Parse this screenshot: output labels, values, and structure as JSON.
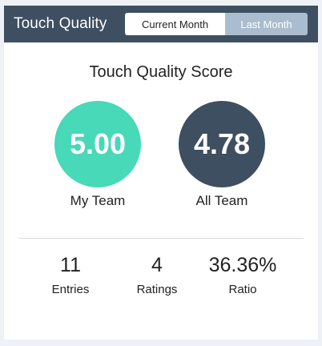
{
  "header": {
    "title": "Touch Quality",
    "tabs": [
      {
        "label": "Current Month",
        "active": true
      },
      {
        "label": "Last Month",
        "active": false
      }
    ]
  },
  "score": {
    "title": "Touch Quality Score",
    "my_team": {
      "value": "5.00",
      "label": "My Team"
    },
    "all_team": {
      "value": "4.78",
      "label": "All Team"
    }
  },
  "stats": [
    {
      "value": "11",
      "label": "Entries"
    },
    {
      "value": "4",
      "label": "Ratings"
    },
    {
      "value": "36.36%",
      "label": "Ratio"
    }
  ],
  "colors": {
    "header_bg": "#3d4f60",
    "my_team_circle": "#47d9b8",
    "all_team_circle": "#3d4f60",
    "inactive_tab": "#a9bdcf"
  }
}
